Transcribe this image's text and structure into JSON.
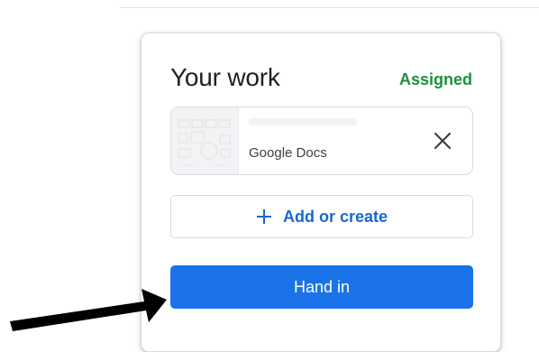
{
  "card": {
    "title": "Your work",
    "status": "Assigned"
  },
  "attachment": {
    "type_label": "Google Docs",
    "remove_icon": "close-icon"
  },
  "buttons": {
    "add_or_create": "Add or create",
    "hand_in": "Hand in"
  },
  "colors": {
    "status_green": "#1e8e3e",
    "primary_blue": "#1a73e8",
    "link_blue": "#1967d2",
    "arrow_black": "#000000"
  }
}
